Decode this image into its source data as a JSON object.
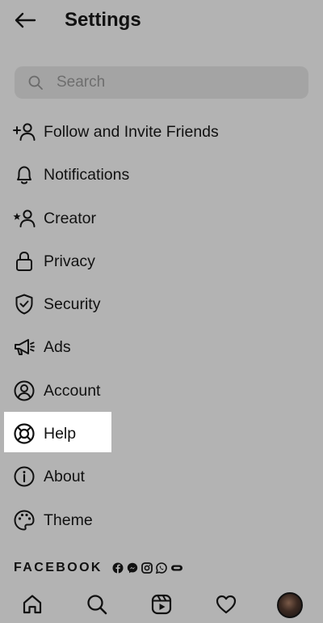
{
  "header": {
    "title": "Settings",
    "back_icon": "arrow-left-icon"
  },
  "search": {
    "placeholder": "Search",
    "value": "",
    "icon": "search-icon"
  },
  "menu": {
    "items": [
      {
        "label": "Follow and Invite Friends",
        "icon": "add-person-icon"
      },
      {
        "label": "Notifications",
        "icon": "bell-icon"
      },
      {
        "label": "Creator",
        "icon": "star-person-icon"
      },
      {
        "label": "Privacy",
        "icon": "lock-icon"
      },
      {
        "label": "Security",
        "icon": "shield-check-icon"
      },
      {
        "label": "Ads",
        "icon": "megaphone-icon"
      },
      {
        "label": "Account",
        "icon": "account-circle-icon"
      },
      {
        "label": "Help",
        "icon": "lifebuoy-icon",
        "highlighted": true
      },
      {
        "label": "About",
        "icon": "info-icon"
      },
      {
        "label": "Theme",
        "icon": "palette-icon"
      }
    ]
  },
  "brand": {
    "label": "FACEBOOK",
    "icons": [
      "facebook-icon",
      "messenger-icon",
      "instagram-icon",
      "whatsapp-icon",
      "portal-icon"
    ]
  },
  "tabbar": {
    "tabs": [
      "home-icon",
      "search-icon",
      "reels-icon",
      "heart-icon",
      "profile-avatar"
    ]
  },
  "colors": {
    "background": "#b3b3b3",
    "search_field": "#a4a4a4",
    "highlight": "#ffffff",
    "text": "#111111"
  }
}
